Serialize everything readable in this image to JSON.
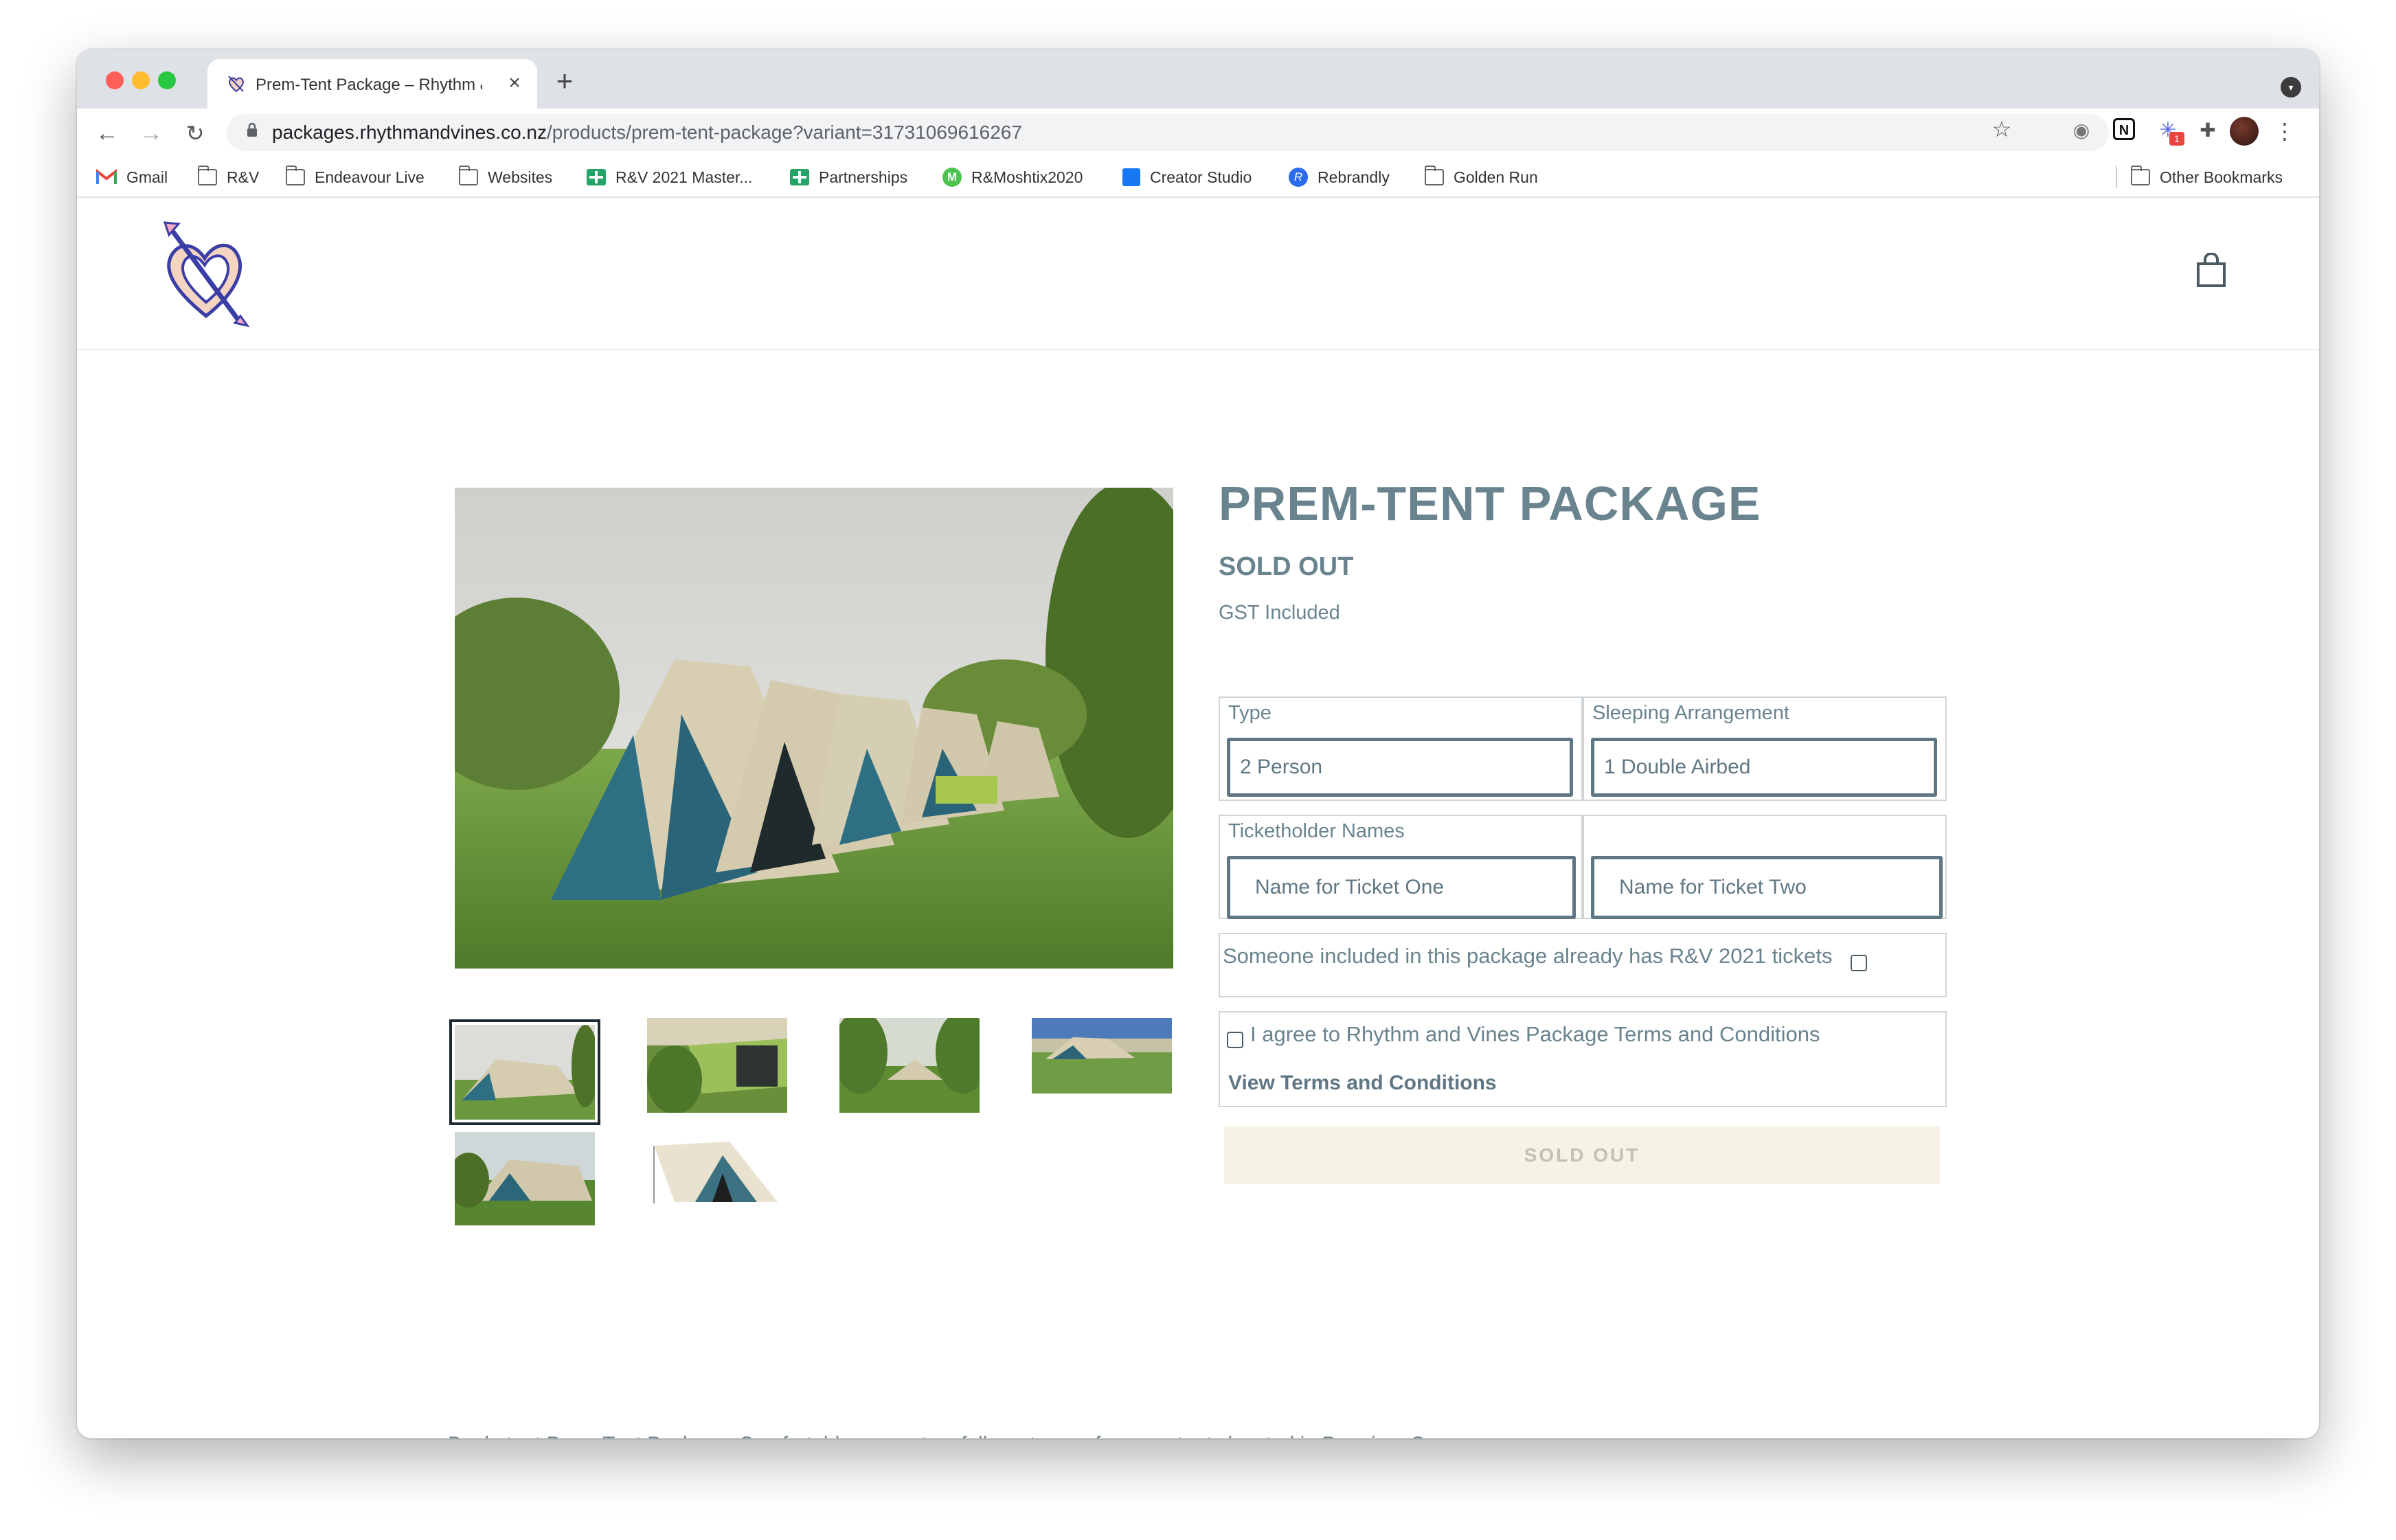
{
  "browser": {
    "tab_title": "Prem-Tent Package – Rhythm & Vines",
    "url_host": "packages.rhythmandvines.co.nz",
    "url_path": "/products/prem-tent-package?variant=31731069616267",
    "extension_badge": "1"
  },
  "bookmarks": [
    {
      "label": "Gmail",
      "icon": "gmail-icon"
    },
    {
      "label": "R&V",
      "icon": "folder-icon"
    },
    {
      "label": "Endeavour Live",
      "icon": "folder-icon"
    },
    {
      "label": "Websites",
      "icon": "folder-icon"
    },
    {
      "label": "R&V 2021 Master...",
      "icon": "sheets-icon"
    },
    {
      "label": "Partnerships",
      "icon": "sheets-icon"
    },
    {
      "label": "R&Moshtix2020",
      "icon": "moshtix-icon"
    },
    {
      "label": "Creator Studio",
      "icon": "calendar-icon"
    },
    {
      "label": "Rebrandly",
      "icon": "rebrandly-icon"
    },
    {
      "label": "Golden Run",
      "icon": "folder-icon"
    },
    {
      "label": "Other Bookmarks",
      "icon": "folder-icon"
    }
  ],
  "product": {
    "title": "PREM-TENT PACKAGE",
    "status": "SOLD OUT",
    "gst_note": "GST Included",
    "type_label": "Type",
    "type_value": "2 Person",
    "sleeping_label": "Sleeping Arrangement",
    "sleeping_value": "1 Double Airbed",
    "ticketholder_label": "Ticketholder Names",
    "ticket_one_placeholder": "Name for Ticket One",
    "ticket_two_placeholder": "Name for Ticket Two",
    "already_tickets_text": "Someone included in this package already has R&V 2021 tickets",
    "agree_text": "I agree to Rhythm and Vines Package Terms and Conditions",
    "terms_link": "View Terms and Conditions",
    "button_label": "SOLD OUT",
    "description": "Bookatent Prem-Tent Package. Comfortable, pre-setup, fully waterproof canvas tents located in Premium Camp."
  },
  "colors": {
    "accent": "#69838f",
    "field_border": "#5f7784",
    "sold_out_bg": "#f6f2e6"
  }
}
